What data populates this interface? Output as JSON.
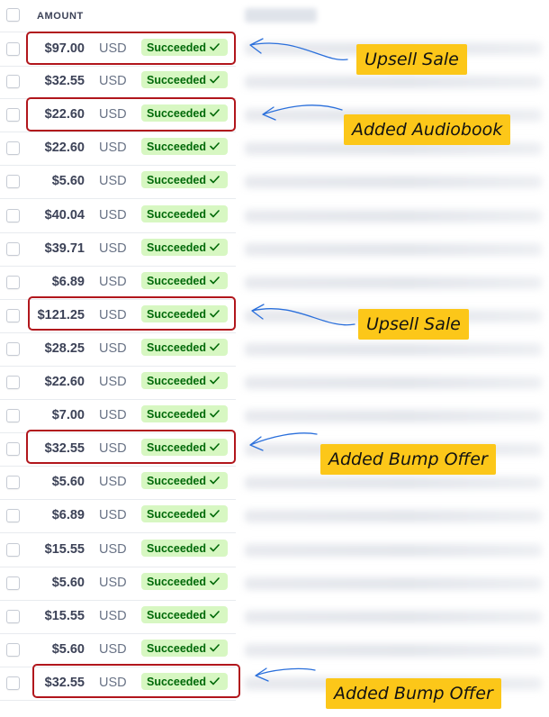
{
  "header": {
    "amount_label": "AMOUNT"
  },
  "rows": [
    {
      "amount": "$97.00",
      "currency": "USD",
      "status": "Succeeded"
    },
    {
      "amount": "$32.55",
      "currency": "USD",
      "status": "Succeeded"
    },
    {
      "amount": "$22.60",
      "currency": "USD",
      "status": "Succeeded"
    },
    {
      "amount": "$22.60",
      "currency": "USD",
      "status": "Succeeded"
    },
    {
      "amount": "$5.60",
      "currency": "USD",
      "status": "Succeeded"
    },
    {
      "amount": "$40.04",
      "currency": "USD",
      "status": "Succeeded"
    },
    {
      "amount": "$39.71",
      "currency": "USD",
      "status": "Succeeded"
    },
    {
      "amount": "$6.89",
      "currency": "USD",
      "status": "Succeeded"
    },
    {
      "amount": "$121.25",
      "currency": "USD",
      "status": "Succeeded"
    },
    {
      "amount": "$28.25",
      "currency": "USD",
      "status": "Succeeded"
    },
    {
      "amount": "$22.60",
      "currency": "USD",
      "status": "Succeeded"
    },
    {
      "amount": "$7.00",
      "currency": "USD",
      "status": "Succeeded"
    },
    {
      "amount": "$32.55",
      "currency": "USD",
      "status": "Succeeded"
    },
    {
      "amount": "$5.60",
      "currency": "USD",
      "status": "Succeeded"
    },
    {
      "amount": "$6.89",
      "currency": "USD",
      "status": "Succeeded"
    },
    {
      "amount": "$15.55",
      "currency": "USD",
      "status": "Succeeded"
    },
    {
      "amount": "$5.60",
      "currency": "USD",
      "status": "Succeeded"
    },
    {
      "amount": "$15.55",
      "currency": "USD",
      "status": "Succeeded"
    },
    {
      "amount": "$5.60",
      "currency": "USD",
      "status": "Succeeded"
    },
    {
      "amount": "$32.55",
      "currency": "USD",
      "status": "Succeeded"
    }
  ],
  "annotations": [
    {
      "label": "Upsell Sale"
    },
    {
      "label": "Added Audiobook"
    },
    {
      "label": "Upsell Sale"
    },
    {
      "label": "Added Bump Offer"
    },
    {
      "label": "Added Bump Offer"
    }
  ],
  "colors": {
    "badge_bg": "#d7f7c2",
    "badge_text": "#006908",
    "highlight_border": "#b1161c",
    "callout_bg": "#fcc719",
    "arrow": "#2a6fdb"
  },
  "icons": {
    "status_icon": "checkmark-icon",
    "row_select": "checkbox-icon"
  }
}
